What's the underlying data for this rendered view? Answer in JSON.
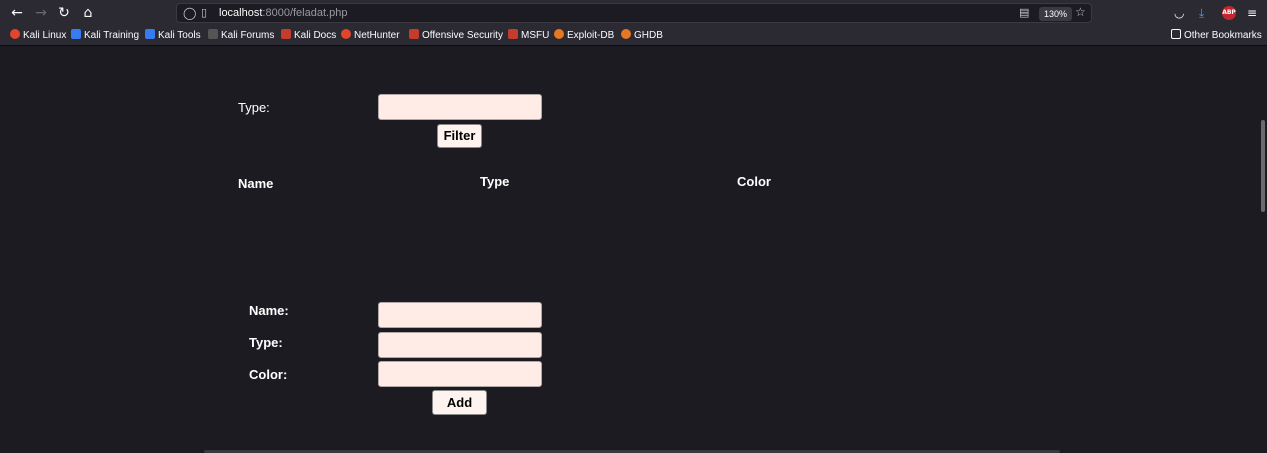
{
  "browser": {
    "url_host": "localhost",
    "url_rest": ":8000/feladat.php",
    "zoom": "130%",
    "bookmarks": [
      {
        "label": "Kali Linux",
        "icon": "kali-icon"
      },
      {
        "label": "Kali Training",
        "icon": "kali-training-icon"
      },
      {
        "label": "Kali Tools",
        "icon": "kali-tools-icon"
      },
      {
        "label": "Kali Forums",
        "icon": "kali-forums-icon"
      },
      {
        "label": "Kali Docs",
        "icon": "kali-docs-icon"
      },
      {
        "label": "NetHunter",
        "icon": "nethunter-icon"
      },
      {
        "label": "Offensive Security",
        "icon": "offsec-icon"
      },
      {
        "label": "MSFU",
        "icon": "msfu-icon"
      },
      {
        "label": "Exploit-DB",
        "icon": "exploitdb-icon"
      },
      {
        "label": "GHDB",
        "icon": "ghdb-icon"
      }
    ],
    "other_bookmarks": "Other Bookmarks",
    "abp_label": "ABP"
  },
  "filter": {
    "type_label": "Type:",
    "type_value": "",
    "button": "Filter"
  },
  "table": {
    "headers": [
      "Name",
      "Type",
      "Color"
    ],
    "rows": []
  },
  "add_form": {
    "name_label": "Name:",
    "type_label": "Type:",
    "color_label": "Color:",
    "name_value": "",
    "type_value": "",
    "color_value": "",
    "button": "Add"
  }
}
